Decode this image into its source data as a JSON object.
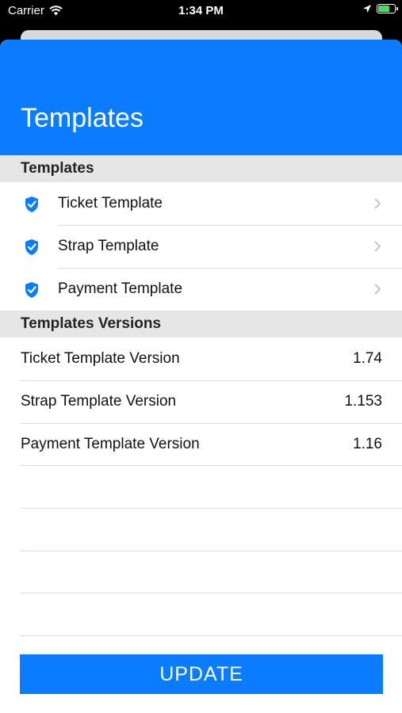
{
  "status_bar": {
    "carrier": "Carrier",
    "time": "1:34 PM"
  },
  "header": {
    "title": "Templates"
  },
  "sections": {
    "templates": {
      "title": "Templates",
      "items": [
        {
          "label": "Ticket Template",
          "icon": "shield-check-icon"
        },
        {
          "label": "Strap Template",
          "icon": "shield-check-icon"
        },
        {
          "label": "Payment Template",
          "icon": "shield-check-icon"
        }
      ]
    },
    "versions": {
      "title": "Templates Versions",
      "items": [
        {
          "label": "Ticket Template Version",
          "value": "1.74"
        },
        {
          "label": "Strap Template Version",
          "value": "1.153"
        },
        {
          "label": "Payment Template Version",
          "value": "1.16"
        }
      ]
    }
  },
  "actions": {
    "update_label": "UPDATE"
  },
  "colors": {
    "accent": "#0a7cff",
    "section_background": "#e6e6e6",
    "separator": "#dcdcdc"
  }
}
